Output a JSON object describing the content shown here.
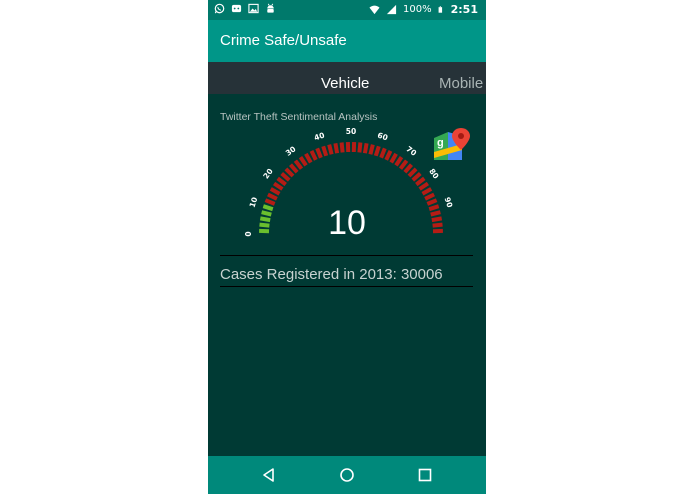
{
  "status_bar": {
    "battery": "100%",
    "time": "2:51"
  },
  "app_bar": {
    "title": "Crime Safe/Unsafe"
  },
  "tabs": [
    {
      "label": "Vehicle",
      "selected": true
    },
    {
      "label": "Mobile",
      "selected": false
    }
  ],
  "analysis": {
    "label": "Twitter Theft Sentimental Analysis"
  },
  "gauge": {
    "value": "10",
    "min": 0,
    "max": 100,
    "ticks": [
      "0",
      "10",
      "20",
      "30",
      "40",
      "50",
      "60",
      "70",
      "80",
      "90"
    ],
    "colors": {
      "good": "#6abf2e",
      "bad": "#b51c15"
    }
  },
  "cases": {
    "text": "Cases Registered in 2013: 30006"
  },
  "colors": {
    "app_bar": "#009688",
    "status_bar": "#00796b",
    "background": "#003a34",
    "tab_bar": "#263238",
    "nav_bar": "#00897b"
  },
  "icons": [
    "whatsapp-icon",
    "messenger-icon",
    "image-icon",
    "android-icon",
    "wifi-icon",
    "signal-icon",
    "battery-icon",
    "google-maps-icon",
    "back-icon",
    "home-icon",
    "recents-icon"
  ]
}
